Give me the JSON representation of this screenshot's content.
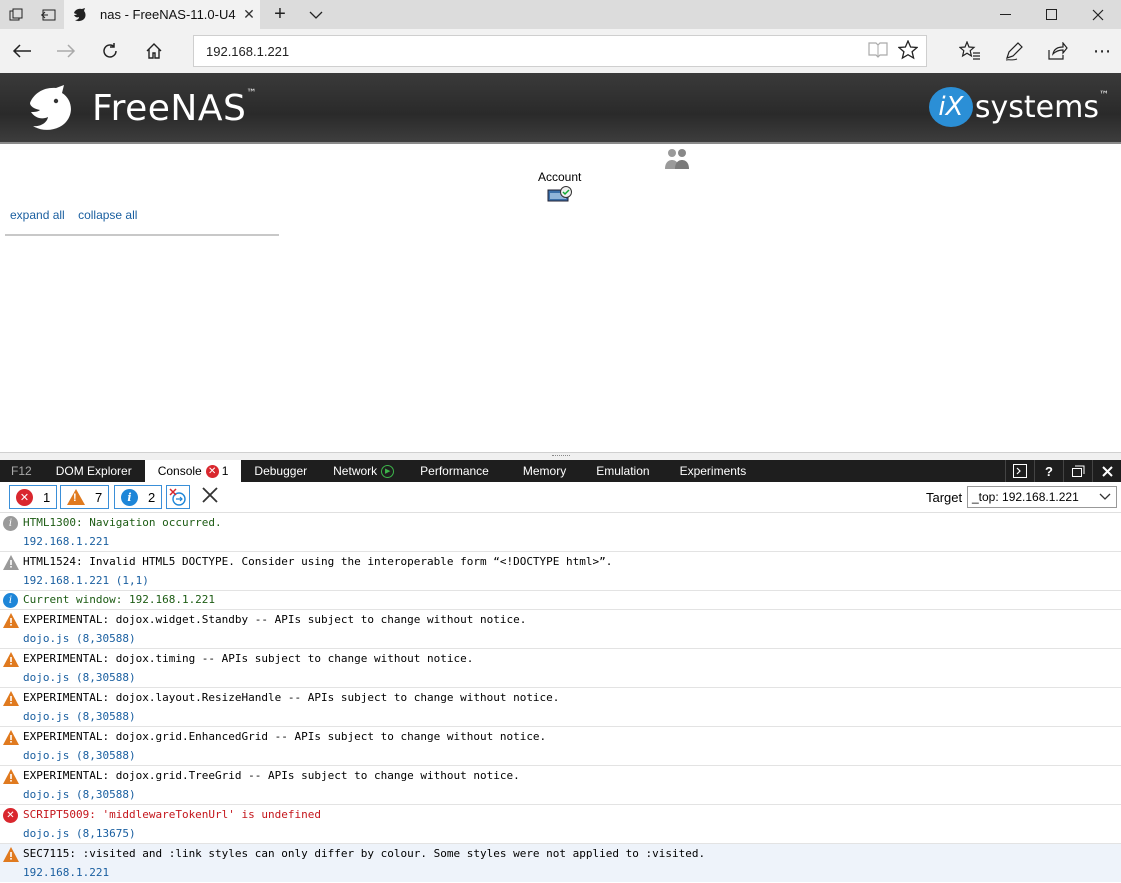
{
  "browser": {
    "tab_title": "nas - FreeNAS-11.0-U4",
    "address": "192.168.1.221"
  },
  "header": {
    "logo_text": "FreeNAS",
    "logo_tm": "™",
    "vendor_mark": "iX",
    "vendor_text": "systems",
    "vendor_tm": "™"
  },
  "page": {
    "account_label": "Account",
    "expand_all": "expand all",
    "collapse_all": "collapse all"
  },
  "devtools": {
    "tabs": [
      {
        "label": "F12"
      },
      {
        "label": "DOM Explorer"
      },
      {
        "label": "Console",
        "badge": "1"
      },
      {
        "label": "Debugger"
      },
      {
        "label": "Network"
      },
      {
        "label": "Performance"
      },
      {
        "label": "Memory"
      },
      {
        "label": "Emulation"
      },
      {
        "label": "Experiments"
      }
    ],
    "filters": {
      "errors": "1",
      "warnings": "7",
      "messages": "2"
    },
    "target_label": "Target",
    "target_value": "_top: 192.168.1.221",
    "messages": [
      {
        "type": "info-gray",
        "text": "HTML1300: Navigation occurred.",
        "source": "192.168.1.221"
      },
      {
        "type": "warn-gray",
        "text": "HTML1524: Invalid HTML5 DOCTYPE. Consider using the interoperable form “<!DOCTYPE html>”.",
        "source": "192.168.1.221 (1,1)"
      },
      {
        "type": "info",
        "text": "Current window: 192.168.1.221",
        "source": ""
      },
      {
        "type": "warn",
        "text": "EXPERIMENTAL: dojox.widget.Standby -- APIs subject to change without notice.",
        "source": "dojo.js (8,30588)"
      },
      {
        "type": "warn",
        "text": "EXPERIMENTAL: dojox.timing -- APIs subject to change without notice.",
        "source": "dojo.js (8,30588)"
      },
      {
        "type": "warn",
        "text": "EXPERIMENTAL: dojox.layout.ResizeHandle -- APIs subject to change without notice.",
        "source": "dojo.js (8,30588)"
      },
      {
        "type": "warn",
        "text": "EXPERIMENTAL: dojox.grid.EnhancedGrid -- APIs subject to change without notice.",
        "source": "dojo.js (8,30588)"
      },
      {
        "type": "warn",
        "text": "EXPERIMENTAL: dojox.grid.TreeGrid -- APIs subject to change without notice.",
        "source": "dojo.js (8,30588)"
      },
      {
        "type": "error",
        "text": "SCRIPT5009: 'middlewareTokenUrl' is undefined",
        "source": "dojo.js (8,13675)"
      },
      {
        "type": "warn",
        "text": "SEC7115: :visited and :link styles can only differ by colour. Some styles were not applied to :visited.",
        "source": "192.168.1.221"
      }
    ]
  }
}
